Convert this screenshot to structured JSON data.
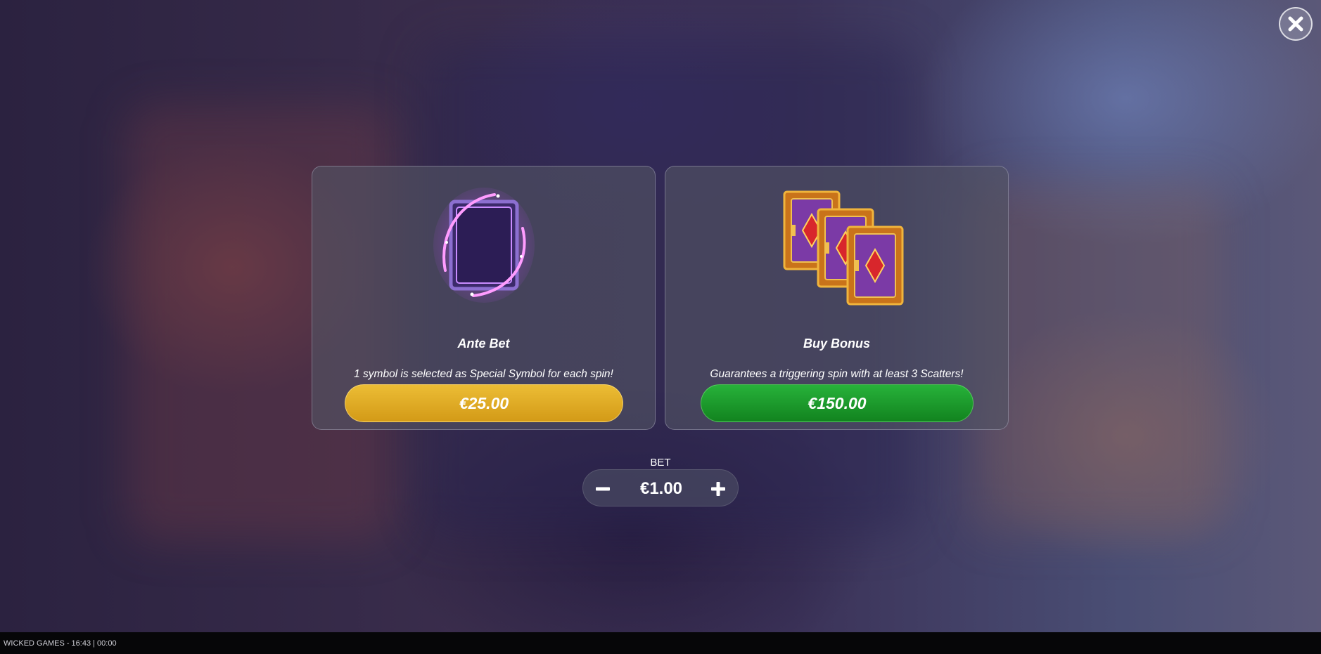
{
  "close": {
    "icon": "close-icon"
  },
  "ante": {
    "icon": "magic-card-frame-icon",
    "title": "Ante Bet",
    "description": "1 symbol is selected as Special Symbol for each spin!",
    "price": "€25.00",
    "button_color": "#dfac26"
  },
  "bonus": {
    "icon": "scatter-books-icon",
    "title": "Buy Bonus",
    "description": "Guarantees a triggering spin with at least 3 Scatters!",
    "price": "€150.00",
    "button_color": "#1c9a2c"
  },
  "bet": {
    "label": "BET",
    "value": "€1.00",
    "minus_icon": "minus-icon",
    "plus_icon": "plus-icon"
  },
  "footer": {
    "text": "WICKED GAMES - 16:43 | 00:00"
  }
}
